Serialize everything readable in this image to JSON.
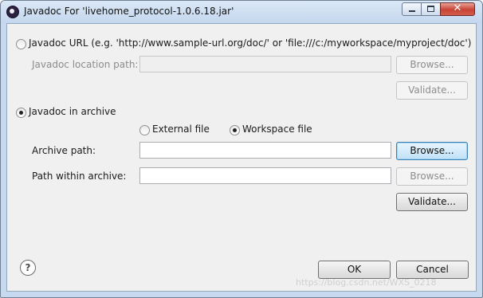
{
  "window": {
    "title": "Javadoc For 'livehome_protocol-1.0.6.18.jar'",
    "icons": {
      "app": "eclipse-icon",
      "minimize": "minimize-icon",
      "maximize": "maximize-icon",
      "close": "close-icon"
    },
    "close_glyph": "✕"
  },
  "url_option": {
    "label": "Javadoc URL (e.g. 'http://www.sample-url.org/doc/' or 'file:///c:/myworkspace/myproject/doc')",
    "selected": false,
    "location_label": "Javadoc location path:",
    "location_value": "",
    "browse_label": "Browse...",
    "validate_label": "Validate..."
  },
  "archive_option": {
    "label": "Javadoc in archive",
    "selected": true,
    "external_label": "External file",
    "external_selected": false,
    "workspace_label": "Workspace file",
    "workspace_selected": true,
    "archive_path_label": "Archive path:",
    "archive_path_value": "",
    "archive_browse_label": "Browse...",
    "path_within_label": "Path within archive:",
    "path_within_value": "",
    "path_browse_label": "Browse...",
    "validate_label": "Validate..."
  },
  "footer": {
    "help_glyph": "?",
    "ok_label": "OK",
    "cancel_label": "Cancel"
  },
  "watermark": "https://blog.csdn.net/WXS_0218",
  "colors": {
    "accent": "#3c7fb1",
    "title_bar": "#c4d7ee",
    "close": "#c74333"
  }
}
